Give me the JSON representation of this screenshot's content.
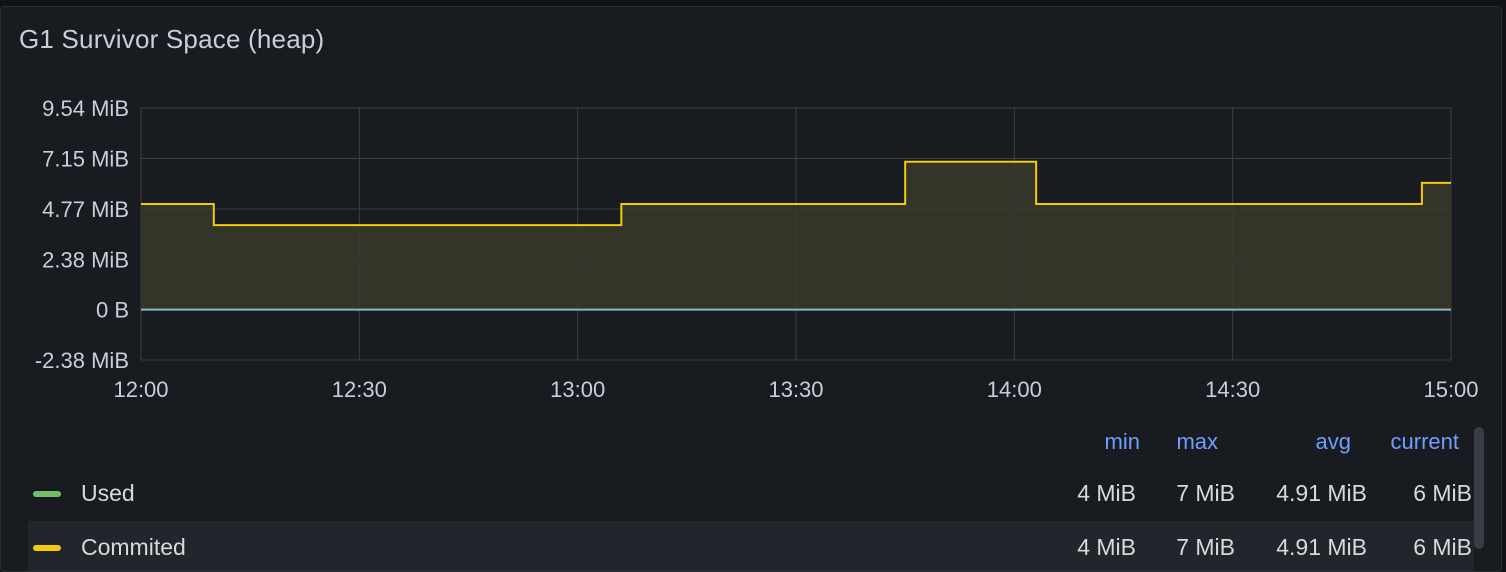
{
  "panel": {
    "title": "G1 Survivor Space (heap)"
  },
  "chart_data": {
    "type": "line",
    "x": [
      "12:00",
      "12:10",
      "13:06",
      "13:06",
      "13:45",
      "13:45",
      "14:03",
      "14:03",
      "14:56",
      "14:56",
      "15:00"
    ],
    "series": [
      {
        "name": "Used",
        "color": "#73bf69",
        "points": [
          [
            "12:00",
            0
          ],
          [
            "15:00",
            0
          ]
        ]
      },
      {
        "name": "Commited",
        "color": "#fade2a",
        "points": [
          [
            "12:00",
            5
          ],
          [
            "12:10",
            5
          ],
          [
            "12:10",
            4
          ],
          [
            "13:06",
            4
          ],
          [
            "13:06",
            5
          ],
          [
            "13:45",
            5
          ],
          [
            "13:45",
            7
          ],
          [
            "14:03",
            7
          ],
          [
            "14:03",
            5
          ],
          [
            "14:56",
            5
          ],
          [
            "14:56",
            6
          ],
          [
            "15:00",
            6
          ]
        ]
      }
    ],
    "x_ticks": [
      "12:00",
      "12:30",
      "13:00",
      "13:30",
      "14:00",
      "14:30",
      "15:00"
    ],
    "y_ticks": [
      "9.54 MiB",
      "7.15 MiB",
      "4.77 MiB",
      "2.38 MiB",
      "0 B",
      "-2.38 MiB"
    ],
    "y_tick_values_mib": [
      9.54,
      7.15,
      4.77,
      2.38,
      0,
      -2.38
    ],
    "ylim_mib": [
      -2.38,
      9.54
    ],
    "xlim": [
      "12:00",
      "15:00"
    ],
    "grid": true,
    "legend_placement": "bottom",
    "unit": "MiB"
  },
  "legend": {
    "headers": {
      "min": "min",
      "max": "max",
      "avg": "avg",
      "current": "current"
    },
    "rows": [
      {
        "name": "Used",
        "color": "#73bf69",
        "min": "4 MiB",
        "max": "7 MiB",
        "avg": "4.91 MiB",
        "current": "6 MiB"
      },
      {
        "name": "Commited",
        "color": "#f2cc0c",
        "min": "4 MiB",
        "max": "7 MiB",
        "avg": "4.91 MiB",
        "current": "6 MiB"
      }
    ]
  },
  "colors": {
    "background": "#111217",
    "panel": "#181b1f",
    "grid": "#3a3d44",
    "header_accent": "#6e9fff",
    "used_line": "#73bf69",
    "used_zero_line": "#8ab8d0",
    "commited_line": "#f2cc0c",
    "commited_fill": "#3a3a2c"
  }
}
